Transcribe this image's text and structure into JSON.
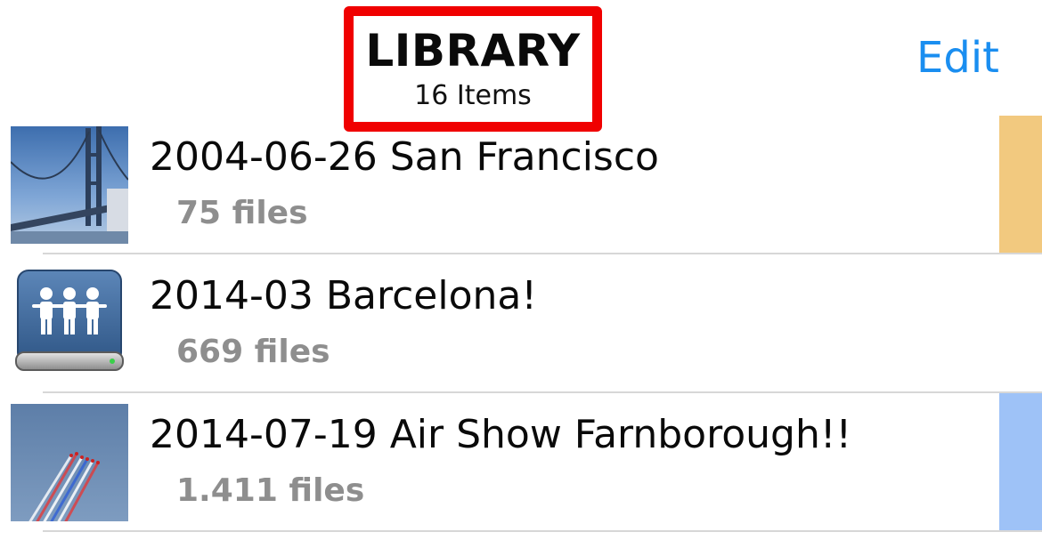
{
  "header": {
    "title": "LIBRARY",
    "subtitle": "16 Items",
    "edit_label": "Edit",
    "highlight_color": "#f00000",
    "edit_color": "#1a8ef0"
  },
  "library": {
    "items": [
      {
        "title": "2004-06-26 San Francisco",
        "subtitle": "75 files",
        "thumbnail": "bridge-photo",
        "strip_color": "#f2c97f"
      },
      {
        "title": "2014-03 Barcelona!",
        "subtitle": "669 files",
        "thumbnail": "shared-drive-icon",
        "strip_color": ""
      },
      {
        "title": "2014-07-19 Air Show Farnborough!!",
        "subtitle": "1.411 files",
        "thumbnail": "airshow-photo",
        "strip_color": "#9ec2f7"
      }
    ]
  }
}
